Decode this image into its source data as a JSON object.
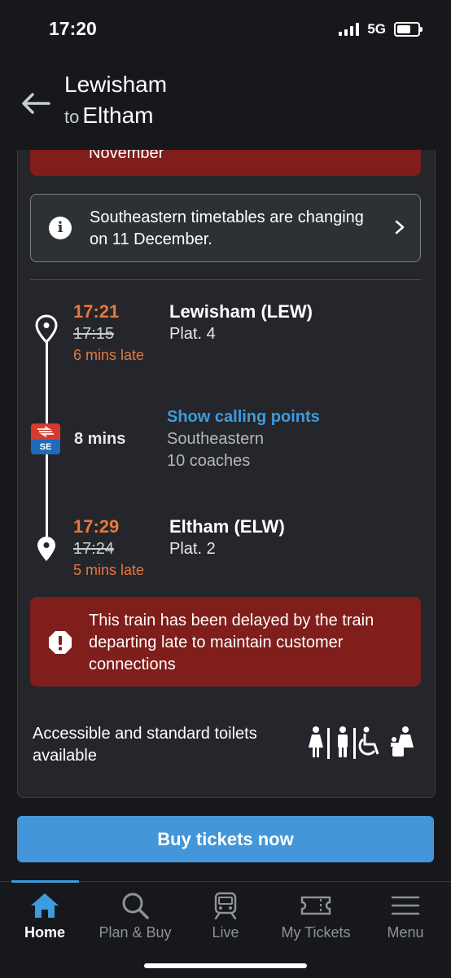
{
  "status_bar": {
    "time": "17:20",
    "network": "5G"
  },
  "header": {
    "from": "Lewisham",
    "to_word": "to",
    "to": "Eltham"
  },
  "top_alert": {
    "text_fragment": "November"
  },
  "info_banner": {
    "text": "Southeastern timetables are changing on 11 December."
  },
  "journey": {
    "departure": {
      "time": "17:21",
      "scheduled": "17:15",
      "late": "6 mins late",
      "station": "Lewisham (LEW)",
      "platform": "Plat. 4"
    },
    "leg": {
      "duration": "8 mins",
      "calling_points_label": "Show calling points",
      "operator": "Southeastern",
      "coaches": "10 coaches",
      "operator_logo_text": "SE"
    },
    "arrival": {
      "time": "17:29",
      "scheduled": "17:24",
      "late": "5 mins late",
      "station": "Eltham (ELW)",
      "platform": "Plat. 2"
    }
  },
  "delay_alert": {
    "text": "This train has been delayed by the train departing late to maintain customer connections"
  },
  "facilities": {
    "text": "Accessible and standard toilets available"
  },
  "buy_button": {
    "label": "Buy tickets now"
  },
  "tabs": [
    {
      "label": "Home",
      "icon": "home-icon",
      "active": true
    },
    {
      "label": "Plan & Buy",
      "icon": "search-icon",
      "active": false
    },
    {
      "label": "Live",
      "icon": "train-icon",
      "active": false
    },
    {
      "label": "My Tickets",
      "icon": "ticket-icon",
      "active": false
    },
    {
      "label": "Menu",
      "icon": "menu-icon",
      "active": false
    }
  ],
  "colors": {
    "accent": "#3d9be0",
    "late": "#e8773a",
    "alert": "#7f1e1b",
    "button": "#4396d9"
  }
}
